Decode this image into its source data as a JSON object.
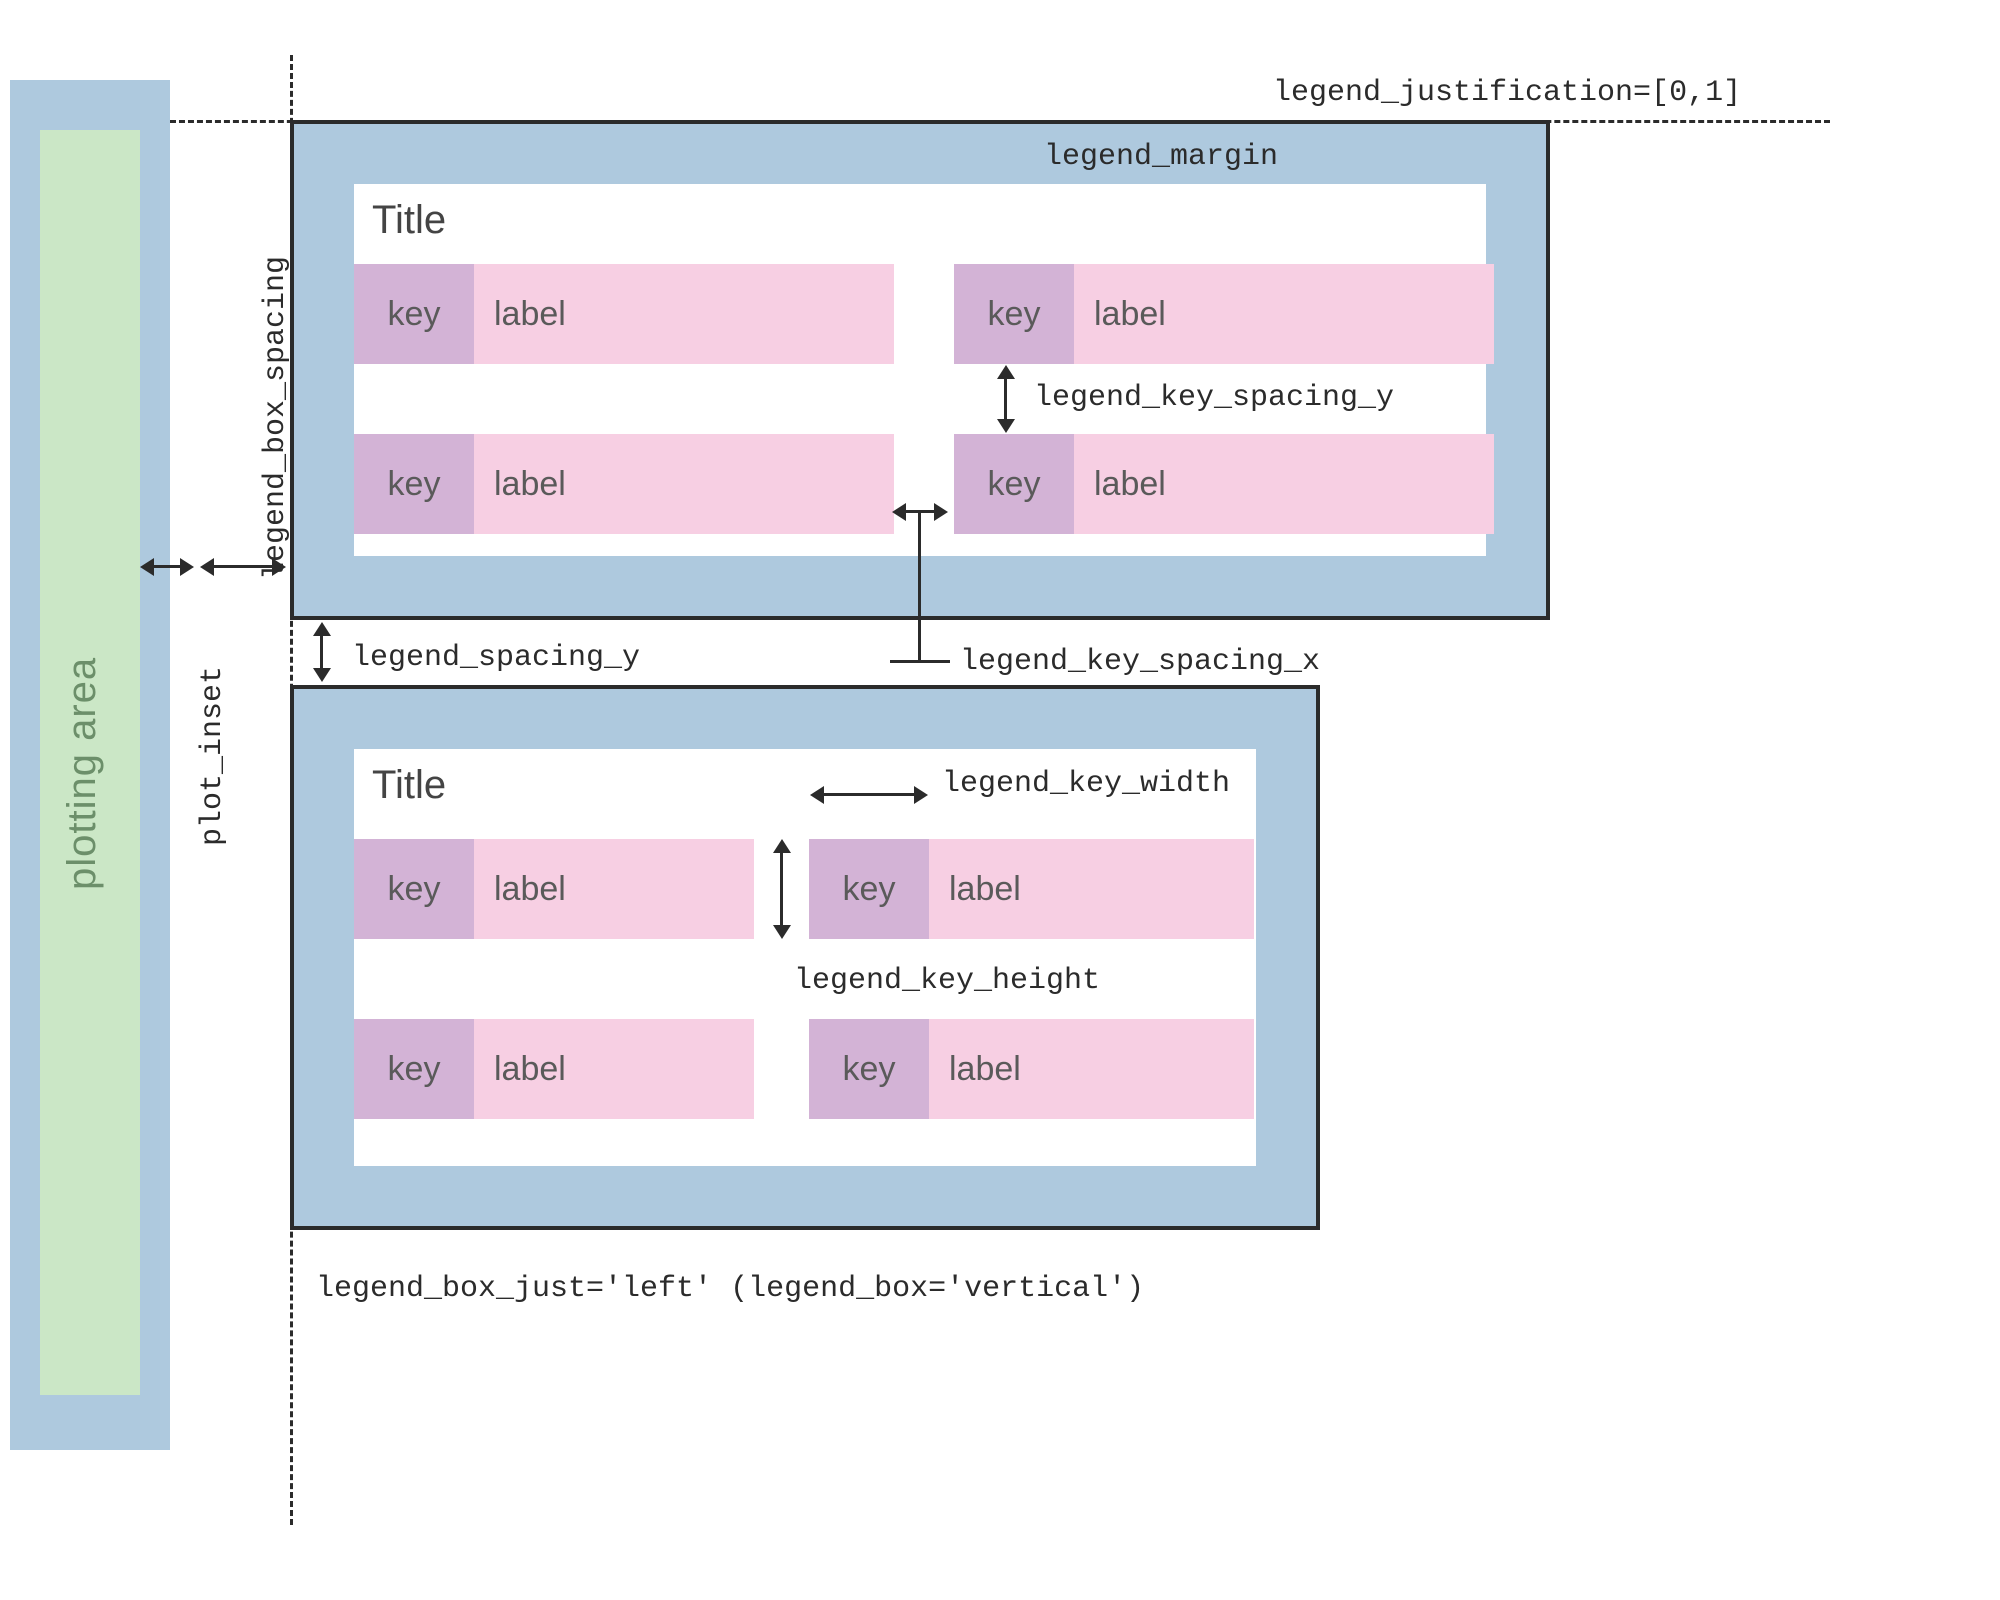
{
  "plot": {
    "label": "plotting area"
  },
  "annotations": {
    "legend_justification": "legend_justification=[0,1]",
    "legend_margin": "legend_margin",
    "plot_inset": "plot_inset",
    "legend_box_spacing": "legend_box_spacing",
    "legend_spacing_y": "legend_spacing_y",
    "legend_key_spacing_y": "legend_key_spacing_y",
    "legend_key_spacing_x": "legend_key_spacing_x",
    "legend_key_width": "legend_key_width",
    "legend_key_height": "legend_key_height",
    "legend_box_just": "legend_box_just='left' (legend_box='vertical')"
  },
  "legend1": {
    "title": "Title",
    "entries": [
      {
        "key": "key",
        "label": "label"
      },
      {
        "key": "key",
        "label": "label"
      },
      {
        "key": "key",
        "label": "label"
      },
      {
        "key": "key",
        "label": "label"
      }
    ]
  },
  "legend2": {
    "title": "Title",
    "entries": [
      {
        "key": "key",
        "label": "label"
      },
      {
        "key": "key",
        "label": "label"
      },
      {
        "key": "key",
        "label": "label"
      },
      {
        "key": "key",
        "label": "label"
      }
    ]
  }
}
